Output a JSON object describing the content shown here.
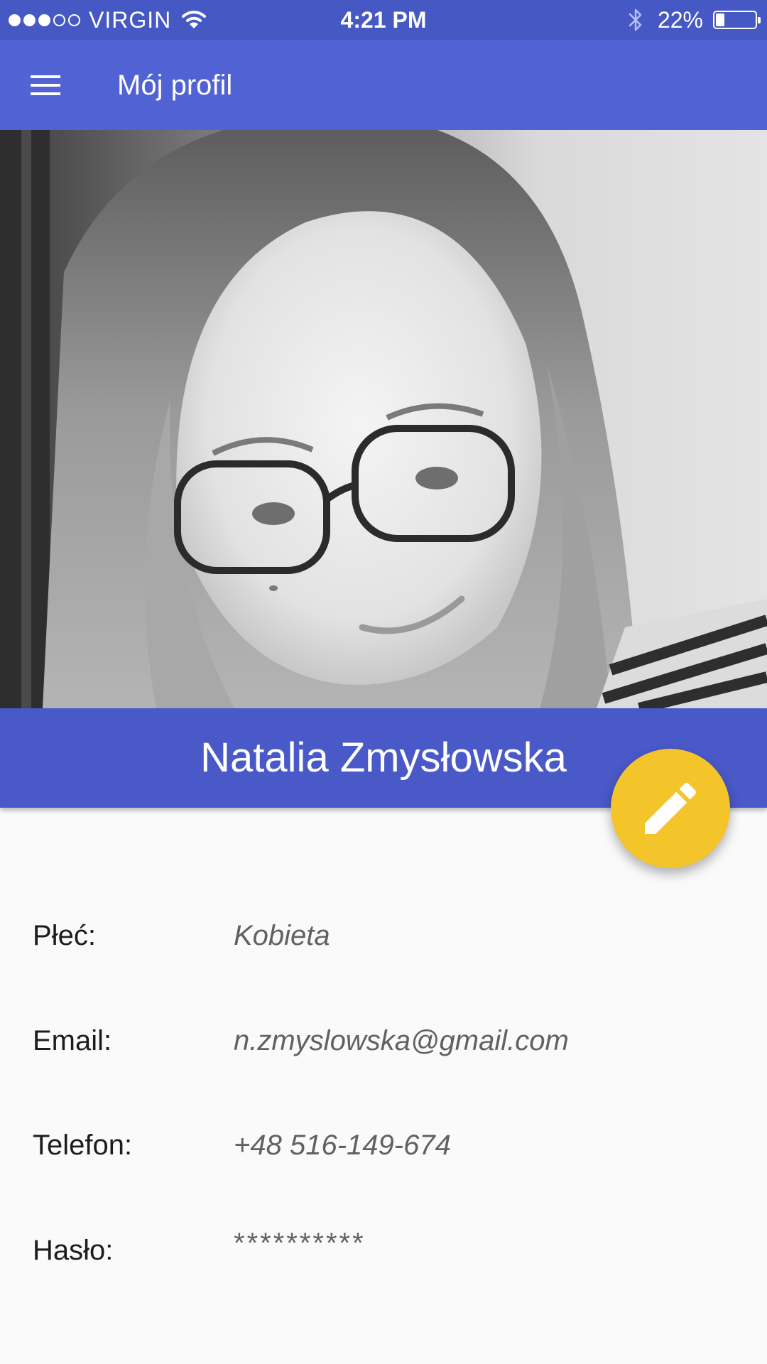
{
  "status_bar": {
    "signal_dots": 5,
    "signal_filled": 3,
    "carrier": "VIRGIN",
    "time": "4:21 PM",
    "battery_percent": "22%",
    "battery_level": 0.22,
    "icons": [
      "wifi-icon",
      "bluetooth-icon",
      "battery-icon"
    ]
  },
  "app_bar": {
    "title": "Mój profil",
    "menu_icon": "hamburger-menu-icon",
    "color": "#5162d4"
  },
  "profile": {
    "name": "Natalia Zmysłowska",
    "fab_icon": "pencil-icon",
    "fab_color": "#f4c52a",
    "name_bar_color": "#4a59c8"
  },
  "details": {
    "gender_label": "Płeć:",
    "gender_value": "Kobieta",
    "email_label": "Email:",
    "email_value": "n.zmyslowska@gmail.com",
    "phone_label": "Telefon:",
    "phone_value": "+48 516-149-674",
    "password_label": "Hasło:",
    "password_value": "**********"
  }
}
